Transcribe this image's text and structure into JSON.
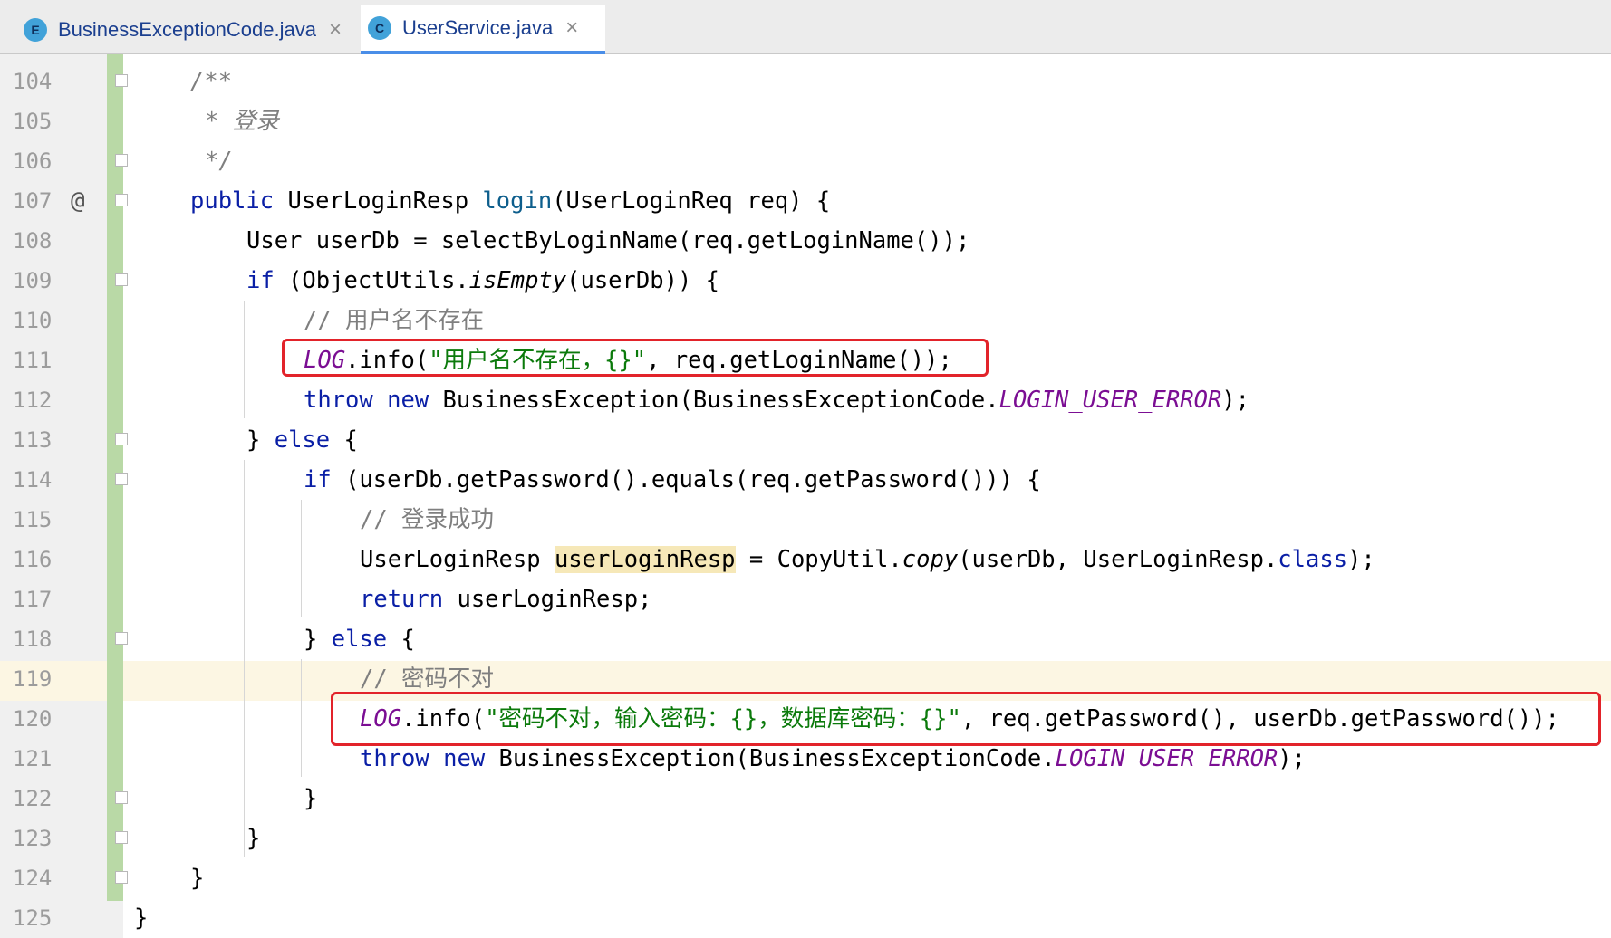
{
  "tabs": [
    {
      "badge": "E",
      "label": "BusinessExceptionCode.java",
      "close": "×",
      "active": false
    },
    {
      "badge": "C",
      "label": "UserService.java",
      "close": "×",
      "active": true
    }
  ],
  "gutter": {
    "line_numbers": [
      "104",
      "105",
      "106",
      "107",
      "108",
      "109",
      "110",
      "111",
      "112",
      "113",
      "114",
      "115",
      "116",
      "117",
      "118",
      "119",
      "120",
      "121",
      "122",
      "123",
      "124",
      "125"
    ],
    "override_marker": "@"
  },
  "code": {
    "l104": "/**",
    "l105": "* 登录",
    "l106": "*/",
    "l107": {
      "kw": "public",
      "type": " UserLoginResp ",
      "method": "login",
      "rest": "(UserLoginReq req) {"
    },
    "l108": "User userDb = selectByLoginName(req.getLoginName());",
    "l109": {
      "kw": "if",
      "a": " (ObjectUtils.",
      "call": "isEmpty",
      "rest": "(userDb)) {"
    },
    "l110": "// 用户名不存在",
    "l111": {
      "field": "LOG",
      "a": ".info(",
      "str": "\"用户名不存在，{}\"",
      "rest": ", req.getLoginName());"
    },
    "l112": {
      "kw1": "throw",
      "kw2": "new",
      "a": " BusinessException(BusinessExceptionCode.",
      "const": "LOGIN_USER_ERROR",
      "rest": ");"
    },
    "l113": {
      "a": "} ",
      "kw": "else",
      "rest": " {"
    },
    "l114": {
      "kw": "if",
      "rest": " (userDb.getPassword().equals(req.getPassword())) {"
    },
    "l115": "// 登录成功",
    "l116": {
      "a": "UserLoginResp ",
      "var": "userLoginResp",
      "b": " = CopyUtil.",
      "call": "copy",
      "c": "(userDb, UserLoginResp.",
      "kw": "class",
      "rest": ");"
    },
    "l117": {
      "kw": "return",
      "rest": " userLoginResp;"
    },
    "l118": {
      "a": "} ",
      "kw": "else",
      "rest": " {"
    },
    "l119": "// 密码不对",
    "l120": {
      "field": "LOG",
      "a": ".info(",
      "str": "\"密码不对，输入密码：{}，数据库密码：{}\"",
      "rest": ", req.getPassword(), userDb.getPassword());"
    },
    "l121": {
      "kw1": "throw",
      "kw2": "new",
      "a": " BusinessException(BusinessExceptionCode.",
      "const": "LOGIN_USER_ERROR",
      "rest": ");"
    },
    "l122": "}",
    "l123": "}",
    "l124": "}",
    "l125": "}"
  },
  "colors": {
    "keyword": "#0a1fa6",
    "string": "#0b7a0b",
    "static_field": "#7b0e93",
    "comment": "#7f7f7f",
    "annotation_box": "#e2232a",
    "vcs_added": "#b9d9a6",
    "current_line": "#fcf6e3"
  },
  "icons": {
    "enum_badge": "enum-class-icon",
    "class_badge": "class-icon",
    "close": "close-icon",
    "fold": "fold-marker-icon"
  }
}
